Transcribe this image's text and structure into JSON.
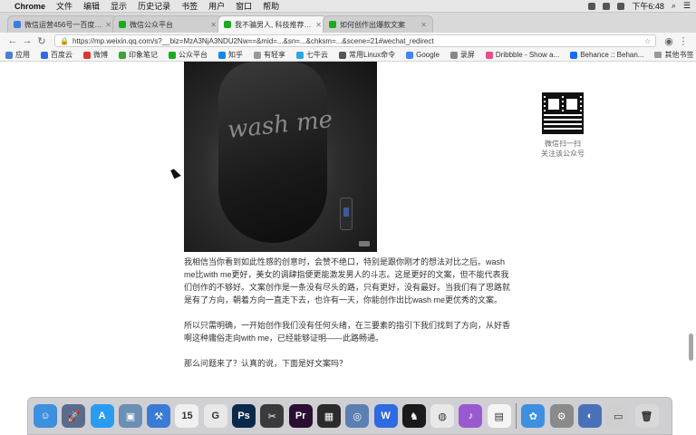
{
  "menubar": {
    "app": "Chrome",
    "items": [
      "文件",
      "编辑",
      "显示",
      "历史记录",
      "书签",
      "用户",
      "窗口",
      "帮助"
    ],
    "clock": "下午6:48"
  },
  "tabs": [
    {
      "label": "微信运营456号一百度搜索",
      "color": "#3b7be8"
    },
    {
      "label": "微信公众平台",
      "color": "#1aad19"
    },
    {
      "label": "我不骗男人, 科技推荐的情报",
      "color": "#1aad19",
      "active": true
    },
    {
      "label": "如何创作出爆款文案",
      "color": "#1aad19"
    }
  ],
  "address": {
    "url": "https://mp.weixin.qq.com/s?__biz=MzA3NjA3NDU2Nw==&mid=...&sn=...&chksm=...&scene=21#wechat_redirect"
  },
  "bookmarks": {
    "items": [
      {
        "label": "应用",
        "color": "#4a7fd6"
      },
      {
        "label": "百度云",
        "color": "#2f6be0"
      },
      {
        "label": "微博",
        "color": "#e0352b"
      },
      {
        "label": "印象笔记",
        "color": "#3aa33a"
      },
      {
        "label": "公众平台",
        "color": "#1aad19"
      },
      {
        "label": "知乎",
        "color": "#0f88eb"
      },
      {
        "label": "有轻享",
        "color": "#999999"
      },
      {
        "label": "七牛云",
        "color": "#2aa8e0"
      },
      {
        "label": "常用Linux命令",
        "color": "#555555"
      },
      {
        "label": "Google",
        "color": "#4285f4"
      },
      {
        "label": "录屏",
        "color": "#888888"
      },
      {
        "label": "Dribbble - Show a...",
        "color": "#ea4c89"
      },
      {
        "label": "Behance :: Behan...",
        "color": "#1769ff"
      }
    ],
    "other": "其他书签"
  },
  "article": {
    "image_print_text": "wash me",
    "paragraph1": "我相信当你看到如此性感的创意时，会赞不绝口，特别是跟你刚才的想法对比之后。wash me比with me更好，美女的调肆指便更能激发男人的斗志。这是更好的文案，但不能代表我们创作的不够好。文案创作是一条没有尽头的路，只有更好，没有最好。当我们有了思路就是有了方向，朝着方向一直走下去，也许有一天，你能创作出比wash me更优秀的文案。",
    "paragraph2": "所以只需明确，一开始创作我们没有任何头绪，在三要素的指引下我们找到了方向，从好香啊这种庸俗走向with me，已经能够证明——此路畅通。",
    "paragraph3": "那么问题来了？认真的说，下面是好文案吗？"
  },
  "qr": {
    "caption_line1": "微信扫一扫",
    "caption_line2": "关注该公众号"
  },
  "dock": [
    {
      "name": "finder",
      "color": "#3d8fe0",
      "glyph": "☺"
    },
    {
      "name": "launchpad",
      "color": "#5a6b8c",
      "glyph": "🚀"
    },
    {
      "name": "app-store",
      "color": "#2a9cf0",
      "glyph": "A"
    },
    {
      "name": "preview",
      "color": "#6b8fb5",
      "glyph": "▣"
    },
    {
      "name": "xcode",
      "color": "#3a7bd5",
      "glyph": "⚒"
    },
    {
      "name": "calendar",
      "color": "#f0f0f0",
      "glyph": "15"
    },
    {
      "name": "chrome-helper",
      "color": "#e8e8e8",
      "glyph": "G"
    },
    {
      "name": "photoshop",
      "color": "#0b2a4a",
      "glyph": "Ps"
    },
    {
      "name": "final-cut",
      "color": "#3a3a3a",
      "glyph": "✂"
    },
    {
      "name": "premiere",
      "color": "#2a0f33",
      "glyph": "Pr"
    },
    {
      "name": "terminal-monitor",
      "color": "#2b2b2b",
      "glyph": "▦"
    },
    {
      "name": "quicktime",
      "color": "#5a7fb0",
      "glyph": "◎"
    },
    {
      "name": "wps",
      "color": "#2f6be0",
      "glyph": "W"
    },
    {
      "name": "qq",
      "color": "#1a1a1a",
      "glyph": "♞"
    },
    {
      "name": "wechat",
      "color": "#e8e8e8",
      "glyph": "◍"
    },
    {
      "name": "music",
      "color": "#9b59d0",
      "glyph": "♪"
    },
    {
      "name": "activity-monitor",
      "color": "#f4f4f4",
      "glyph": "▤"
    },
    {
      "name": "separator"
    },
    {
      "name": "downloads-stack",
      "color": "#3d8fe0",
      "glyph": "✿"
    },
    {
      "name": "system-preferences",
      "color": "#8a8a8a",
      "glyph": "⚙"
    },
    {
      "name": "display",
      "color": "#4a70b8",
      "glyph": "◐"
    },
    {
      "name": "folder",
      "color": "#cfcfcf",
      "glyph": "▭"
    },
    {
      "name": "trash",
      "color": "#d8d8d8",
      "glyph": "🗑"
    }
  ]
}
